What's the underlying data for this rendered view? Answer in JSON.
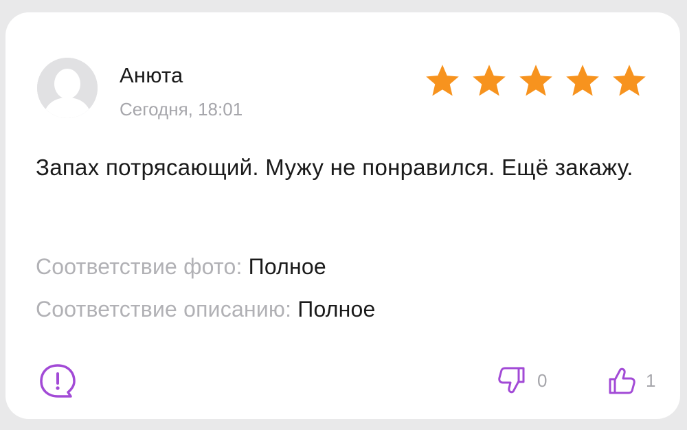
{
  "review": {
    "author": "Анюта",
    "date": "Сегодня, 18:01",
    "rating": 5,
    "rating_max": 5,
    "text": "Запах потрясающий. Мужу не понравился. Ещё закажу.",
    "attributes": [
      {
        "label": "Соответствие фото:",
        "value": "Полное"
      },
      {
        "label": "Соответствие описанию:",
        "value": "Полное"
      }
    ],
    "dislikes": "0",
    "likes": "1"
  },
  "colors": {
    "star": "#f7931e",
    "accent": "#a24ad6",
    "muted": "#a6a6ab",
    "text": "#1a1a1a"
  },
  "icons": {
    "avatar": "user-avatar-placeholder",
    "report": "report-icon",
    "dislike": "thumbs-down-icon",
    "like": "thumbs-up-icon",
    "star": "star-icon"
  }
}
